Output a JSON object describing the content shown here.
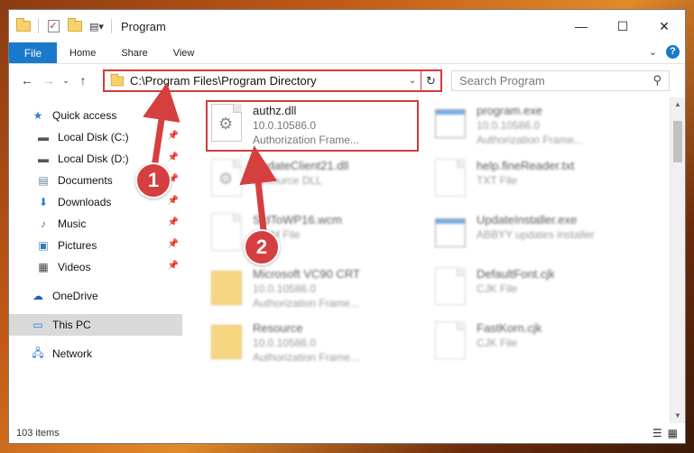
{
  "window": {
    "title": "Program",
    "controls": {
      "minimize": "—",
      "maximize": "☐",
      "close": "✕"
    }
  },
  "ribbon": {
    "file_tab": "File",
    "tabs": [
      "Home",
      "Share",
      "View"
    ],
    "help": "?"
  },
  "address": {
    "path": "C:\\Program Files\\Program Directory",
    "search_placeholder": "Search Program"
  },
  "sidebar": {
    "quick_access": "Quick access",
    "items": [
      {
        "label": "Local Disk (C:)",
        "icon": "drive-icon"
      },
      {
        "label": "Local Disk (D:)",
        "icon": "drive-icon"
      },
      {
        "label": "Documents",
        "icon": "documents-icon"
      },
      {
        "label": "Downloads",
        "icon": "downloads-icon"
      },
      {
        "label": "Music",
        "icon": "music-icon"
      },
      {
        "label": "Pictures",
        "icon": "pictures-icon"
      },
      {
        "label": "Videos",
        "icon": "videos-icon"
      }
    ],
    "onedrive": "OneDrive",
    "this_pc": "This PC",
    "network": "Network"
  },
  "files": [
    {
      "name": "authz.dll",
      "meta1": "10.0.10586.0",
      "meta2": "Authorization Frame...",
      "kind": "dll"
    },
    {
      "name": "program.exe",
      "meta1": "10.0.10586.0",
      "meta2": "Authorization Frame...",
      "kind": "exe"
    },
    {
      "name": "UpdateClient21.dll",
      "meta1": "Resource DLL",
      "meta2": "",
      "kind": "dll"
    },
    {
      "name": "help.fineReader.txt",
      "meta1": "TXT File",
      "meta2": "",
      "kind": "doc"
    },
    {
      "name": "StdToWP16.wcm",
      "meta1": "WCM File",
      "meta2": "",
      "kind": "doc"
    },
    {
      "name": "UpdateInstaller.exe",
      "meta1": "ABBYY updates installer",
      "meta2": "",
      "kind": "app"
    },
    {
      "name": "Microsoft VC90 CRT",
      "meta1": "10.0.10586.0",
      "meta2": "Authorization Frame...",
      "kind": "folder"
    },
    {
      "name": "DefaultFont.cjk",
      "meta1": "CJK File",
      "meta2": "",
      "kind": "doc"
    },
    {
      "name": "Resource",
      "meta1": "10.0.10586.0",
      "meta2": "Authorization Frame...",
      "kind": "folder"
    },
    {
      "name": "FastKorn.cjk",
      "meta1": "CJK File",
      "meta2": "",
      "kind": "doc"
    }
  ],
  "status": {
    "count": "103 items"
  },
  "callouts": {
    "one": "1",
    "two": "2"
  },
  "colors": {
    "highlight": "#d03b3b",
    "accent": "#1979ca"
  }
}
